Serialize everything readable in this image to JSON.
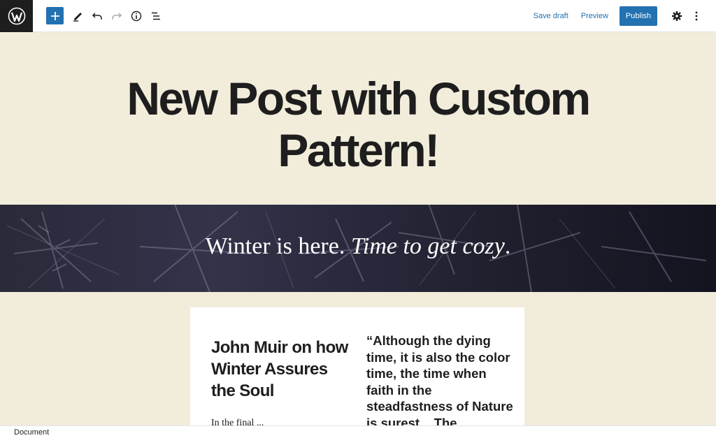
{
  "toolbar": {
    "icons": {
      "logo": "wordpress-logo",
      "inserter": "plus-icon",
      "tools": "pencil-icon",
      "undo": "undo-icon",
      "redo": "redo-icon",
      "details": "info-icon",
      "outline": "list-view-icon",
      "settings": "gear-icon",
      "options": "vertical-ellipsis-icon"
    },
    "save_draft_label": "Save draft",
    "preview_label": "Preview",
    "publish_label": "Publish"
  },
  "post": {
    "title": "New Post with Custom Pattern!"
  },
  "cover": {
    "text_plain": "Winter is here.",
    "text_italic": "Time to get cozy",
    "text_end": "."
  },
  "card": {
    "heading": "John Muir on how Winter Assures the Soul",
    "body_partial": "In the final ...",
    "quote": "“Although the dying time, it is also the color time, the time when faith in the steadfastness of Nature is surest... The"
  },
  "footer": {
    "breadcrumb": "Document"
  },
  "colors": {
    "accent": "#2271b1",
    "canvas_bg": "#f2ecdb",
    "logo_bg": "#1e1e1e",
    "text": "#1e1e1e"
  }
}
